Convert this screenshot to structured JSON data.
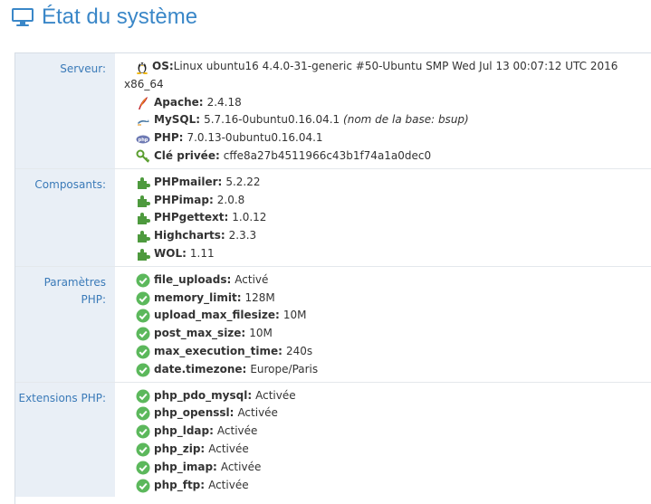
{
  "header": {
    "title": "État du système"
  },
  "sections": {
    "server": {
      "label": "Serveur:",
      "os": {
        "key": "OS:",
        "value": "Linux ubuntu16 4.4.0-31-generic #50-Ubuntu SMP Wed Jul 13 00:07:12 UTC 2016",
        "value_cont": "x86_64"
      },
      "apache": {
        "key": "Apache:",
        "value": "2.4.18"
      },
      "mysql": {
        "key": "MySQL:",
        "value": "5.7.16-0ubuntu0.16.04.1",
        "note": "(nom de la base: bsup)"
      },
      "php": {
        "key": "PHP:",
        "value": "7.0.13-0ubuntu0.16.04.1"
      },
      "key": {
        "key": "Clé privée:",
        "value": "cffe8a27b4511966c43b1f74a1a0dec0"
      }
    },
    "components": {
      "label": "Composants:",
      "items": [
        {
          "key": "PHPmailer:",
          "value": "5.2.22"
        },
        {
          "key": "PHPimap:",
          "value": "2.0.8"
        },
        {
          "key": "PHPgettext:",
          "value": "1.0.12"
        },
        {
          "key": "Highcharts:",
          "value": "2.3.3"
        },
        {
          "key": "WOL:",
          "value": "1.11"
        }
      ]
    },
    "php_params": {
      "label_line1": "Paramètres",
      "label_line2": "PHP:",
      "items": [
        {
          "key": "file_uploads:",
          "value": "Activé"
        },
        {
          "key": "memory_limit:",
          "value": "128M"
        },
        {
          "key": "upload_max_filesize:",
          "value": "10M"
        },
        {
          "key": "post_max_size:",
          "value": "10M"
        },
        {
          "key": "max_execution_time:",
          "value": "240s"
        },
        {
          "key": "date.timezone:",
          "value": "Europe/Paris"
        }
      ]
    },
    "php_ext": {
      "label": "Extensions PHP:",
      "items": [
        {
          "key": "php_pdo_mysql:",
          "value": "Activée"
        },
        {
          "key": "php_openssl:",
          "value": "Activée"
        },
        {
          "key": "php_ldap:",
          "value": "Activée"
        },
        {
          "key": "php_zip:",
          "value": "Activée"
        },
        {
          "key": "php_imap:",
          "value": "Activée"
        },
        {
          "key": "php_ftp:",
          "value": "Activée"
        }
      ]
    }
  },
  "colors": {
    "accent": "#3a87c8",
    "label_bg": "#e9eff6",
    "check": "#5cb85c",
    "plugin": "#4e9a3e"
  }
}
